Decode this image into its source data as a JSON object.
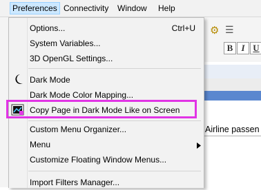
{
  "menubar": {
    "items": [
      {
        "label": "Preferences",
        "active": true
      },
      {
        "label": "Connectivity"
      },
      {
        "label": "Window"
      },
      {
        "label": "Help"
      }
    ]
  },
  "menu": {
    "items": [
      {
        "label": "Options...",
        "shortcut": "Ctrl+U"
      },
      {
        "label": "System Variables..."
      },
      {
        "label": "3D OpenGL Settings..."
      },
      {
        "label": "Dark Mode",
        "icon": "moon-icon"
      },
      {
        "label": "Dark Mode Color Mapping..."
      },
      {
        "label": "Copy Page in Dark Mode Like on Screen",
        "icon": "copy-page-dark-icon",
        "highlighted": true
      },
      {
        "label": "Custom Menu Organizer..."
      },
      {
        "label": "Menu",
        "submenu": true
      },
      {
        "label": "Customize Floating Window Menus..."
      },
      {
        "label": "Import Filters Manager..."
      }
    ]
  },
  "background": {
    "text_snippet": "Airline passen",
    "toolbar_buttons": [
      "B",
      "I",
      "U"
    ]
  },
  "colors": {
    "highlight_border": "#e133e5",
    "menu_bg": "#f2f2f2",
    "menubar_active": "#cce8ff"
  }
}
